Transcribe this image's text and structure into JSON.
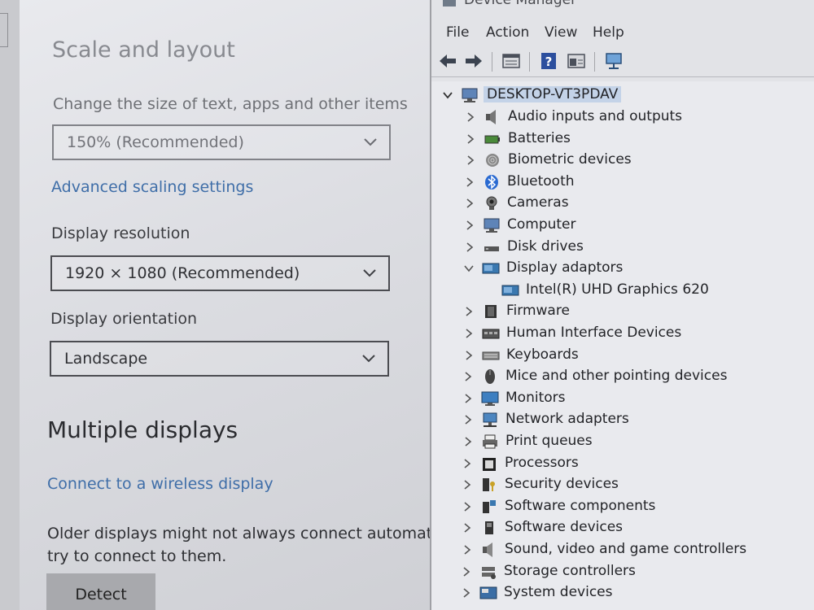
{
  "settings": {
    "heading": "Scale and layout",
    "scale_label": "Change the size of text, apps and other items",
    "scale_value": "150% (Recommended)",
    "advanced_link": "Advanced scaling settings",
    "resolution_label": "Display resolution",
    "resolution_value": "1920 × 1080 (Recommended)",
    "orientation_label": "Display orientation",
    "orientation_value": "Landscape",
    "multiple_heading": "Multiple displays",
    "wireless_link": "Connect to a wireless display",
    "older_text_line1": "Older displays might not always connect automatic",
    "older_text_line2": "try to connect to them.",
    "detect_button": "Detect"
  },
  "device_manager": {
    "title": "Device Manager",
    "menu": [
      "File",
      "Action",
      "View",
      "Help"
    ],
    "root": "DESKTOP-VT3PDAV",
    "items": [
      {
        "label": "Audio inputs and outputs",
        "icon": "speaker-icon"
      },
      {
        "label": "Batteries",
        "icon": "battery-icon"
      },
      {
        "label": "Biometric devices",
        "icon": "fingerprint-icon"
      },
      {
        "label": "Bluetooth",
        "icon": "bluetooth-icon"
      },
      {
        "label": "Cameras",
        "icon": "camera-icon"
      },
      {
        "label": "Computer",
        "icon": "computer-icon"
      },
      {
        "label": "Disk drives",
        "icon": "disk-drive-icon"
      },
      {
        "label": "Display adaptors",
        "icon": "display-adapter-icon",
        "expanded": true
      },
      {
        "label": "Intel(R) UHD Graphics 620",
        "icon": "display-adapter-icon",
        "child": true
      },
      {
        "label": "Firmware",
        "icon": "firmware-icon"
      },
      {
        "label": "Human Interface Devices",
        "icon": "hid-icon"
      },
      {
        "label": "Keyboards",
        "icon": "keyboard-icon"
      },
      {
        "label": "Mice and other pointing devices",
        "icon": "mouse-icon"
      },
      {
        "label": "Monitors",
        "icon": "monitor-icon"
      },
      {
        "label": "Network adapters",
        "icon": "network-adapter-icon"
      },
      {
        "label": "Print queues",
        "icon": "printer-icon"
      },
      {
        "label": "Processors",
        "icon": "processor-icon"
      },
      {
        "label": "Security devices",
        "icon": "security-device-icon"
      },
      {
        "label": "Software components",
        "icon": "software-component-icon"
      },
      {
        "label": "Software devices",
        "icon": "software-device-icon"
      },
      {
        "label": "Sound, video and game controllers",
        "icon": "sound-controller-icon"
      },
      {
        "label": "Storage controllers",
        "icon": "storage-controller-icon"
      },
      {
        "label": "System devices",
        "icon": "system-devices-icon"
      }
    ]
  }
}
